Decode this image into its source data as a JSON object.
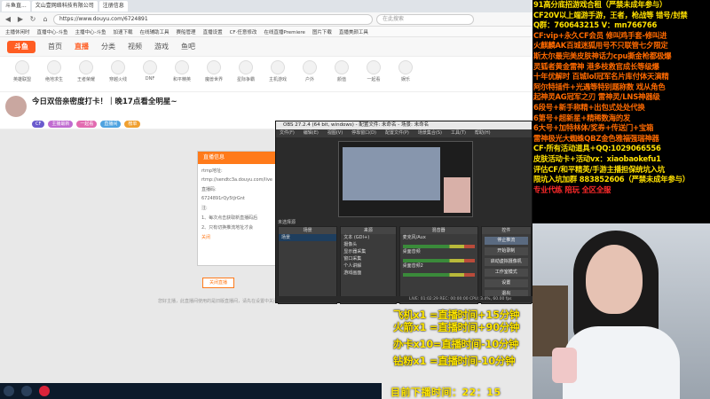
{
  "browser": {
    "tabs": [
      "斗鱼直...",
      "文山壹网络科技有限公司",
      "注册信息"
    ],
    "url": "https://www.douyu.com/6724891",
    "search_placeholder": "在此搜索",
    "bookmarks": [
      "主播休闲时",
      "直播中心-斗鱼",
      "主播中心-斗鱼",
      "加速下载",
      "在线辅助工具",
      "赛船管理",
      "直播设置",
      "CF·任意修改",
      "在线直播Premiere",
      "图片下载",
      "直播美颜工具"
    ]
  },
  "douyu": {
    "logo": "斗鱼",
    "nav": [
      "首页",
      "直播",
      "分类",
      "视频",
      "游戏",
      "鱼吧"
    ],
    "active_nav": "直播",
    "categories": [
      "英雄联盟",
      "绝地求生",
      "王者荣耀",
      "穿越火线",
      "DNF",
      "和平精英",
      "魔兽世界",
      "星际争霸",
      "主机游戏",
      "户外",
      "颜值",
      "一起看",
      "娱乐"
    ],
    "room_title": "今日双倍亲密度打卡！｜晚17点看全明星~",
    "tags": [
      "CF",
      "主播最新",
      "一起看",
      "直播间",
      "榜单"
    ],
    "modal": {
      "title": "直播信息",
      "rtmp_label": "rtmp地址:",
      "rtmp_value": "rtmp://sendtc3a.douyu.com/live",
      "code_label": "直播码:",
      "code_value": "6724891rQy5tJrGnt",
      "note": "注:",
      "tip1": "1、每次点击获取新直播码后",
      "tip2": "2、只有切换推流地址才会",
      "confirm": "关闭"
    },
    "stop_button": "关闭直播",
    "footer_hint": "您好主播，此直播间使用的是旧版直播间，请先在设置中关闭后再开启"
  },
  "obs": {
    "title": "OBS 27.2.4 (64 bit, windows) - 配置文件: 未命名 - 场景: 未命名",
    "menu": [
      "文件(F)",
      "编辑(E)",
      "视图(V)",
      "停靠窗口(D)",
      "配置文件(P)",
      "场景集合(S)",
      "工具(T)",
      "帮助(H)"
    ],
    "no_source_label": "未选择源",
    "panels": {
      "scenes": "场景",
      "sources": "来源",
      "mixer": "混音器",
      "controls": "控件"
    },
    "scenes": [
      "场景"
    ],
    "sources": [
      "文本 (GDI+)",
      "摄像头",
      "显示器采集",
      "窗口采集",
      "个人讲解",
      "游戏画面"
    ],
    "mixer_tracks": [
      "麦克风/Aux",
      "桌面音频",
      "桌面音频2"
    ],
    "controls": [
      "停止推流",
      "开始录制",
      "启动虚拟摄像机",
      "工作室模式",
      "设置",
      "退出"
    ],
    "status": "LIVE: 01:02:29  REC: 00:00:00  CPU: 3.4%, 60.00 fps"
  },
  "right_panel": {
    "lines": [
      {
        "text": "91高分底招游戏合租（严禁未成年参与）",
        "color": "#ffe000"
      },
      {
        "text": "CF20V以上端游手游，王者，枪战等 错号/封禁",
        "color": "#ffe000"
      },
      {
        "text": "Q群：760643215    V：mn766766",
        "color": "#ffe000"
      },
      {
        "text": "CF:vip+永久CF会员  修叫鸡手套-修叫进",
        "color": "#ff6a00"
      },
      {
        "text": "火麒麟AK百城迷狐用号不只联管七夕限定",
        "color": "#ff6a00"
      },
      {
        "text": "斯太尔最完美皮肤神话力cpu撕金枪都极爆",
        "color": "#ff6a00"
      },
      {
        "text": "灵狐者黄金雷神 港多枝救官成长等级爆",
        "color": "#ff6a00"
      },
      {
        "text": "十年优解时 百城lol冠军名片库付体天演精",
        "color": "#ff6a00"
      },
      {
        "text": "阿尔特插件+光遇等特别题称数 戏从角色",
        "color": "#ff6a00"
      },
      {
        "text": "起神灵AG冠军之刃 雷神灵/LNS神器级",
        "color": "#ff6a00"
      },
      {
        "text": "6段号+新手称精+出包式处处代换",
        "color": "#ff6a00"
      },
      {
        "text": "6第号+超新星+精稀数海的发",
        "color": "#ff6a00"
      },
      {
        "text": "6大号+加特林体/奖券+传送门+宝箱",
        "color": "#ff6a00"
      },
      {
        "text": "雷神极光大蜘蛛QBZ金色雅福强瑞神器",
        "color": "#ff6a00"
      },
      {
        "text": "CF·所有活动道具+QQ:1029066556",
        "color": "#ffe000"
      },
      {
        "text": "皮肤活动卡+活动vx：xiaobaokefu1",
        "color": "#ffe000"
      },
      {
        "text": "评估CF/和平精英/手游主播担保统坑入坑",
        "color": "#ffe000"
      },
      {
        "text": "限坑入坑加群 883852606（严禁未成年参与）",
        "color": "#ffe000"
      },
      {
        "text": "专业代练 陪玩 全区全服",
        "color": "#ff2a2a"
      }
    ]
  },
  "overlay": {
    "rules": [
      "飞机x1 =直播时间+15分钟",
      "火箭x1 =直播时间+90分钟",
      "办卡x10=直播时间-10分钟",
      "钻粉x1 =直播时间-10分钟"
    ],
    "countdown_label": "目前下播时间：",
    "countdown_value": "22：15"
  },
  "colors": {
    "accent": "#ff5d23",
    "overlay_yellow": "#ffe600",
    "overlay_orange": "#ff6a00",
    "obs_bg": "#2b2b2b"
  }
}
